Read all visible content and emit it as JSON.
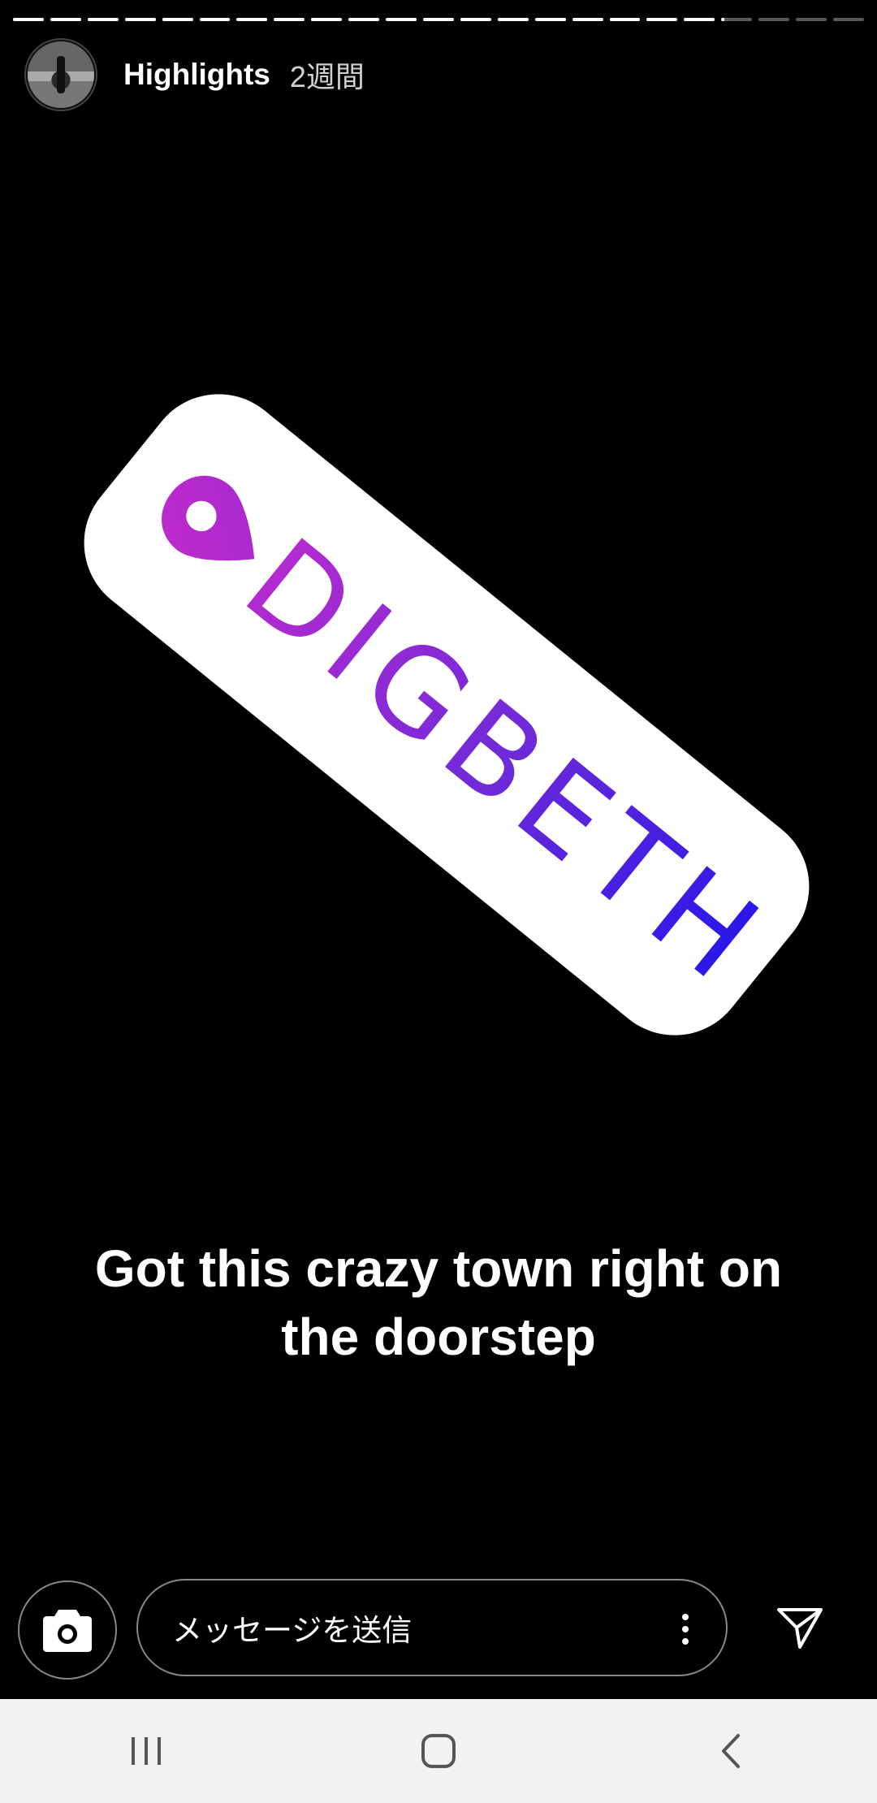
{
  "story": {
    "total_segments": 23,
    "completed_segments": 19,
    "current_segment_progress": 0.1
  },
  "header": {
    "username": "Highlights",
    "time_ago": "2週間"
  },
  "sticker": {
    "text": "DIGBETH",
    "icon": "location-pin-icon",
    "gradient_start": "#b42bd0",
    "gradient_end": "#2616ea"
  },
  "caption": {
    "line1": "Got this crazy town right on",
    "line2": "the doorstep"
  },
  "reply_bar": {
    "message_placeholder": "メッセージを送信",
    "camera_icon": "camera-icon",
    "more_icon": "more-vertical-icon",
    "send_icon": "send-icon"
  },
  "navbar": {
    "recents_icon": "recents-icon",
    "home_icon": "home-icon",
    "back_icon": "back-icon"
  }
}
